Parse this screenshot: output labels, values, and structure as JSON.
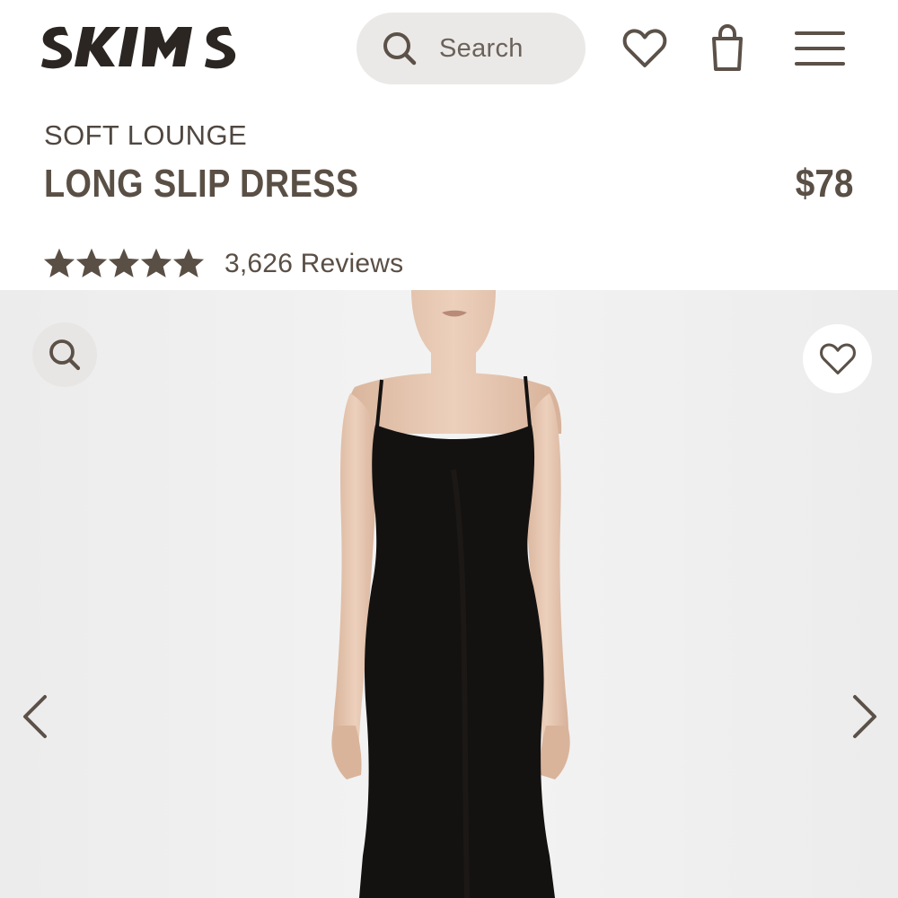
{
  "brand": {
    "logo_text": "SKIMS"
  },
  "header": {
    "search_placeholder": "Search",
    "icons": {
      "search": "search-icon",
      "wishlist": "heart-icon",
      "bag": "shopping-bag-icon",
      "menu": "hamburger-menu-icon"
    }
  },
  "product": {
    "collection": "SOFT LOUNGE",
    "title": "LONG SLIP DRESS",
    "price": "$78",
    "rating": 5,
    "rating_max": 5,
    "reviews_label": "3,626 Reviews"
  },
  "gallery": {
    "icons": {
      "zoom": "zoom-icon",
      "favorite": "heart-icon",
      "prev": "chevron-left-icon",
      "next": "chevron-right-icon"
    }
  },
  "colors": {
    "text": "#5a4f45",
    "icon": "#5b5148",
    "logo": "#2b2622",
    "search_bg": "#ebe9e7",
    "gallery_bg": "#efefef",
    "dress": "#141211",
    "skin": "#e3c4ae"
  }
}
